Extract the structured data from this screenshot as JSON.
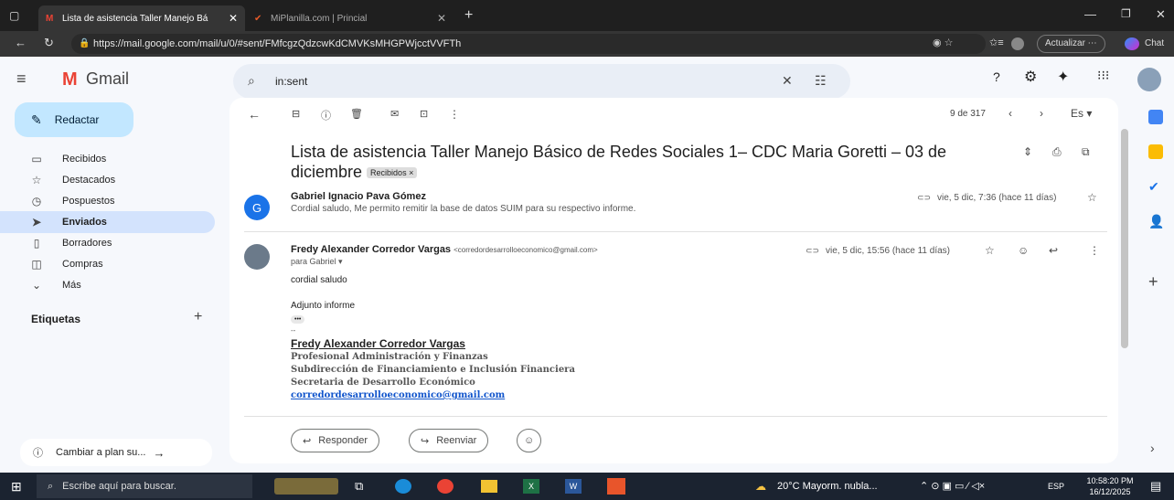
{
  "browser": {
    "tab1": "Lista de asistencia Taller Manejo Bá",
    "tab2": "MiPlanilla.com | Princial",
    "url": "https://mail.google.com/mail/u/0/#sent/FMfcgzQdzcwKdCMVKsMHGPWjcctVVFTh",
    "update": "Actualizar",
    "chat": "Chat"
  },
  "gmail": {
    "logo": "Gmail",
    "search": "in:sent",
    "compose": "Redactar",
    "nav": [
      {
        "label": "Recibidos",
        "icon": "▭"
      },
      {
        "label": "Destacados",
        "icon": "☆"
      },
      {
        "label": "Pospuestos",
        "icon": "◷"
      },
      {
        "label": "Enviados",
        "icon": "➤"
      },
      {
        "label": "Borradores",
        "icon": "▯"
      },
      {
        "label": "Compras",
        "icon": "◫"
      },
      {
        "label": "Más",
        "icon": "⌄"
      }
    ],
    "labels": "Etiquetas",
    "upgrade": "Cambiar a plan su..."
  },
  "thread": {
    "count": "9 de 317",
    "lang": "Es",
    "subject": "Lista de asistencia Taller Manejo Básico de Redes Sociales 1– CDC Maria Goretti – 03 de diciembre",
    "badge": "Recibidos ×",
    "msg1": {
      "from": "Gabriel Ignacio Pava Gómez",
      "avatar": "G",
      "date": "vie, 5 dic, 7:36 (hace 11 días)",
      "snippet": "Cordial saludo, Me permito remitir la base de datos SUIM para su respectivo informe."
    },
    "msg2": {
      "from": "Fredy Alexander Corredor Vargas",
      "email": "<corredordesarrolloeconomico@gmail.com>",
      "date": "vie, 5 dic, 15:56 (hace 11 días)",
      "to": "para Gabriel",
      "body1": "cordial saludo",
      "body2": "Adjunto informe",
      "dots": "•••",
      "dash": "--",
      "sig_name": "Fredy Alexander Corredor Vargas",
      "sig1": "Profesional Administración y Finanzas",
      "sig2": "Subdirección de Financiamiento e Inclusión  Financiera",
      "sig3": "Secretaria de Desarrollo Económico",
      "sig_mail": "corredordesarrolloeconomico@gmail.com"
    },
    "reply": "Responder",
    "forward": "Reenviar"
  },
  "taskbar": {
    "search": "Escribe aquí para buscar.",
    "weather": "20°C  Mayorm. nubla...",
    "lang": "ESP",
    "time": "10:58:20 PM",
    "date": "16/12/2025"
  }
}
